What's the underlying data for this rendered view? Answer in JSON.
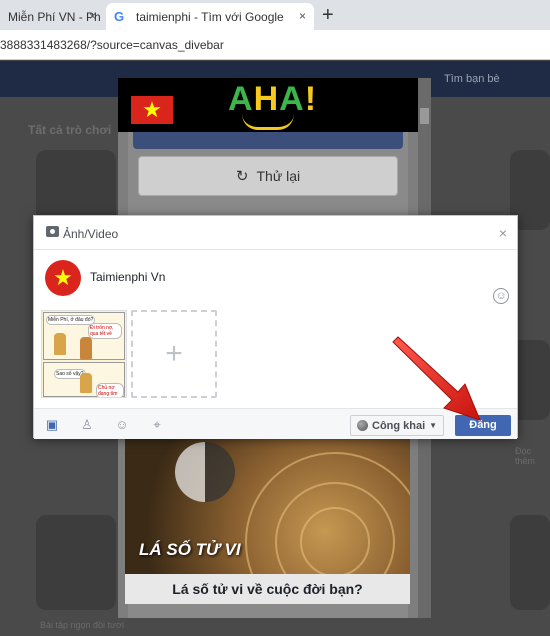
{
  "browser": {
    "tabs": [
      {
        "label": "Miễn Phí VN - Ph",
        "active": false
      },
      {
        "label": "taimienphi - Tìm với Google",
        "active": true
      }
    ],
    "close_glyph": "×",
    "new_tab_glyph": "+",
    "url": "3888331483268/?source=canvas_divebar"
  },
  "facebook": {
    "topbar_items": [
      "Tìm bạn bè"
    ],
    "section_heading": "Tất cả trò chơi",
    "ghost_captions": [
      "Đọc thêm",
      "Bài tập ngọn đồi tươi"
    ]
  },
  "game": {
    "retry_label": "Thử lại",
    "retry_icon": "refresh-icon",
    "banner_logo": "AHA!",
    "image_overlay_text": "LÁ SỐ TỬ VI",
    "caption": "Lá số tử vi về cuộc đời bạn?"
  },
  "modal": {
    "title": "Ảnh/Video",
    "close_glyph": "×",
    "user_name": "Taimienphi Vn",
    "thumbnail_texts": [
      "Miễn Phí, ở đâu đó?",
      "Đi trốn nợ, qua tết về",
      "Sao số vậy?",
      "Chủ nợ đang tìm"
    ],
    "add_glyph": "+",
    "footer_icons": [
      "photo-icon",
      "tag-people-icon",
      "feeling-icon",
      "location-icon"
    ],
    "audience_label": "Công khai",
    "post_label": "Đăng"
  },
  "colors": {
    "facebook_blue": "#4267b2",
    "annotation_red": "#e8231c",
    "flag_red": "#da251d"
  }
}
